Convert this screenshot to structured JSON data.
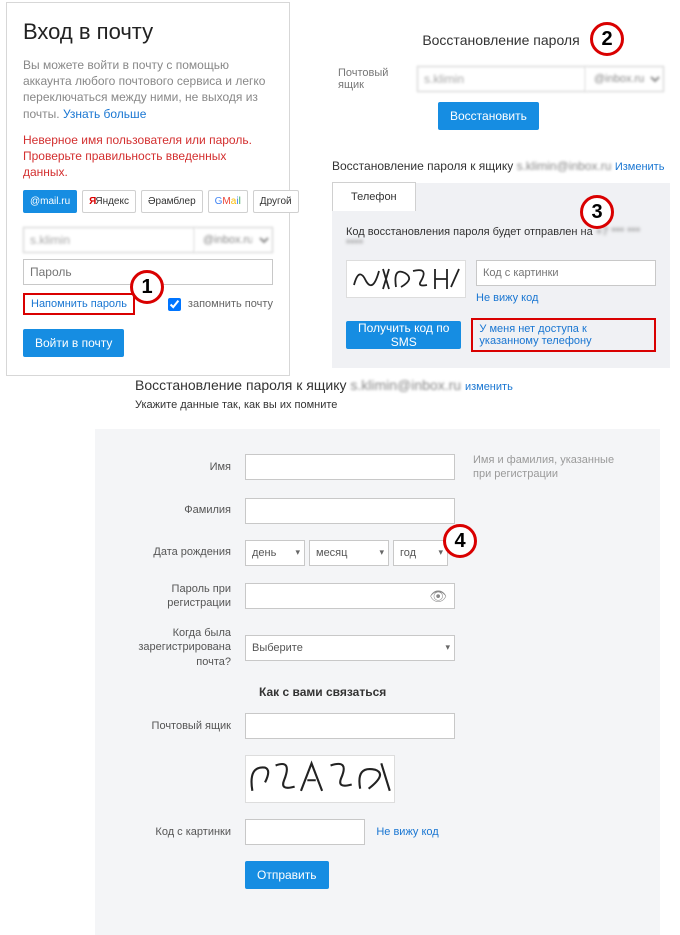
{
  "login": {
    "title": "Вход в почту",
    "desc_text": "Вы можете войти в почту с помощью аккаунта любого почтового сервиса и легко переключаться между ними, не выходя из почты. ",
    "learn_more": "Узнать больше",
    "error": "Неверное имя пользователя или пароль. Проверьте правильность введенных данных.",
    "providers": {
      "mailru": "@mail.ru",
      "yandex": "Яндекс",
      "rambler": "Әрамблер",
      "other": "Другой"
    },
    "email_value": "s.klimin",
    "domain_value": "@inbox.ru",
    "password_placeholder": "Пароль",
    "remind_link": "Напомнить пароль",
    "remember_label": "запомнить почту",
    "signin_btn": "Войти в почту"
  },
  "recover": {
    "title": "Восстановление пароля",
    "mailbox_label": "Почтовый ящик",
    "email_value": "s.klimin",
    "domain_value": "@inbox.ru",
    "submit_btn": "Восстановить"
  },
  "phone": {
    "heading_prefix": "Восстановление пароля к ящику ",
    "heading_email": "s.klimin@inbox.ru",
    "change_link": "Изменить",
    "tab_phone": "Телефон",
    "msg_prefix": "Код восстановления пароля будет отправлен на ",
    "msg_target": "+7 *** *** ****",
    "captcha_placeholder": "Код с картинки",
    "captcha_refresh": "Не вижу код",
    "sms_btn": "Получить код по SMS",
    "no_access": "У меня нет доступа к указанному телефону"
  },
  "form": {
    "heading_prefix": "Восстановление пароля к ящику ",
    "heading_email": "s.klimin@inbox.ru",
    "change_link": "изменить",
    "subtitle": "Укажите данные так, как вы их помните",
    "labels": {
      "name": "Имя",
      "surname": "Фамилия",
      "dob": "Дата рождения",
      "password": "Пароль при регистрации",
      "when": "Когда была зарегистрирована почта?",
      "mailbox": "Почтовый ящик",
      "code": "Код с картинки"
    },
    "hint_name": "Имя и фамилия, указанные при регистрации",
    "dob": {
      "day": "день",
      "month": "месяц",
      "year": "год"
    },
    "when_select": "Выберите",
    "section_contact": "Как с вами связаться",
    "captcha_refresh": "Не вижу код",
    "submit_btn": "Отправить"
  },
  "steps": {
    "s1": "1",
    "s2": "2",
    "s3": "3",
    "s4": "4"
  }
}
